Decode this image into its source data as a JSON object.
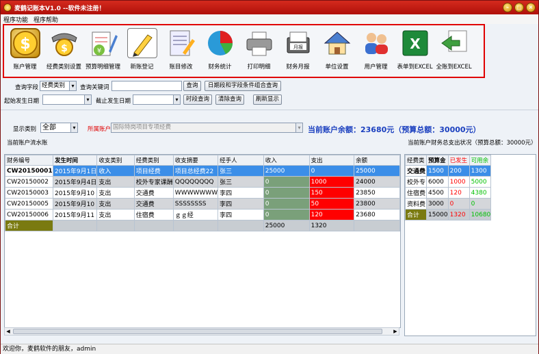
{
  "window": {
    "title": "麦鹤记账本V1.0 --软件未注册！"
  },
  "menu": [
    "程序功能",
    "程序帮助"
  ],
  "toolbar": [
    {
      "label": "账户管理",
      "icon": "dollar-coin-icon"
    },
    {
      "label": "经费类别设置",
      "icon": "money-bag-icon"
    },
    {
      "label": "预算明细管理",
      "icon": "budget-notebook-icon"
    },
    {
      "label": "新账登记",
      "icon": "pencil-note-icon"
    },
    {
      "label": "账目修改",
      "icon": "edit-document-icon"
    },
    {
      "label": "财务统计",
      "icon": "pie-chart-icon"
    },
    {
      "label": "打印明细",
      "icon": "printer-icon"
    },
    {
      "label": "财务月报",
      "icon": "monthly-report-icon"
    },
    {
      "label": "单位设置",
      "icon": "house-icon"
    },
    {
      "label": "用户管理",
      "icon": "users-icon"
    },
    {
      "label": "表单到EXCEL",
      "icon": "excel-icon"
    },
    {
      "label": "全账到EXCEL",
      "icon": "excel-export-icon"
    }
  ],
  "search": {
    "field_label": "查询字段",
    "field_value": "经费类别",
    "keyword_label": "查询关键词",
    "keyword_value": "",
    "query_btn": "查询",
    "combo_btn": "日期段和字段条件组合查询",
    "start_label": "起始发生日期",
    "end_label": "截止发生日期",
    "start_value": "",
    "end_value": "",
    "period_btn": "时段查询",
    "clear_btn": "清除查询",
    "refresh_btn": "刷新显示"
  },
  "filter": {
    "type_label": "显示类别",
    "type_value": "全部",
    "account_label": "所属账户",
    "account_value": "国际特岗项目专项经费"
  },
  "balance": "当前账户余额：23680元（预算总额：30000元）",
  "ledger": {
    "title": "当前账户流水账",
    "columns": [
      "财务编号",
      "发生时间",
      "收支类别",
      "经费类别",
      "收支摘要",
      "经手人",
      "收入",
      "支出",
      "余额"
    ],
    "rows": [
      [
        "CW20150001",
        "2015年9月1日",
        "收入",
        "项目经费",
        "项目总经费22",
        "张三",
        "25000",
        "0",
        "25000"
      ],
      [
        "CW20150002",
        "2015年9月4日",
        "支出",
        "校外专家课酬",
        "QQQQQQQQ",
        "张三",
        "0",
        "1000",
        "24000"
      ],
      [
        "CW20150003",
        "2015年9月10",
        "支出",
        "交通费",
        "WWWWWWW",
        "李四",
        "0",
        "150",
        "23850"
      ],
      [
        "CW20150005",
        "2015年9月10",
        "支出",
        "交通费",
        "SSSSSSSS",
        "李四",
        "0",
        "50",
        "23800"
      ],
      [
        "CW20150006",
        "2015年9月11",
        "支出",
        "住宿费",
        "ｇｇ经",
        "李四",
        "0",
        "120",
        "23680"
      ]
    ],
    "total": [
      "合计",
      "",
      "",
      "",
      "",
      "",
      "25000",
      "1320",
      ""
    ]
  },
  "summary": {
    "title": "当前账户财务总支出状况（预算总额：30000元）",
    "columns": [
      "经费类",
      "预算金",
      "已发生",
      "可用余"
    ],
    "rows": [
      [
        "交通费",
        "1500",
        "200",
        "1300"
      ],
      [
        "校外专",
        "6000",
        "1000",
        "5000"
      ],
      [
        "住宿费",
        "4500",
        "120",
        "4380"
      ],
      [
        "资料费",
        "3000",
        "0",
        "0"
      ],
      [
        "合计",
        "15000",
        "1320",
        "10680"
      ]
    ]
  },
  "status": "欢迎你，麦鹤软件的朋友，admin",
  "colors": {
    "accent": "#1a3fbf",
    "expense": "#ff0000",
    "available": "#00c000",
    "selected": "#3b8ee8"
  }
}
